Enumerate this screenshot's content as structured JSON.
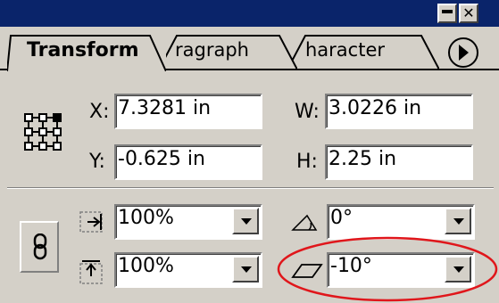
{
  "window": {
    "minimize_icon": "minimize-icon",
    "close_glyph": "✕"
  },
  "tabs": [
    {
      "label": "Transform",
      "active": true
    },
    {
      "label": "ragraph",
      "active": false
    },
    {
      "label": "haracter",
      "active": false
    }
  ],
  "panel_menu_icon": "right-arrow-icon",
  "position": {
    "x_label": "X:",
    "x_value": "7.3281 in",
    "y_label": "Y:",
    "y_value": "-0.625 in"
  },
  "size": {
    "w_label": "W:",
    "w_value": "3.0226 in",
    "h_label": "H:",
    "h_value": "2.25 in"
  },
  "scale": {
    "horizontal_value": "100%",
    "vertical_value": "100%"
  },
  "rotate_value": "0°",
  "shear_value": "-10°",
  "highlight_color": "#e0161b"
}
